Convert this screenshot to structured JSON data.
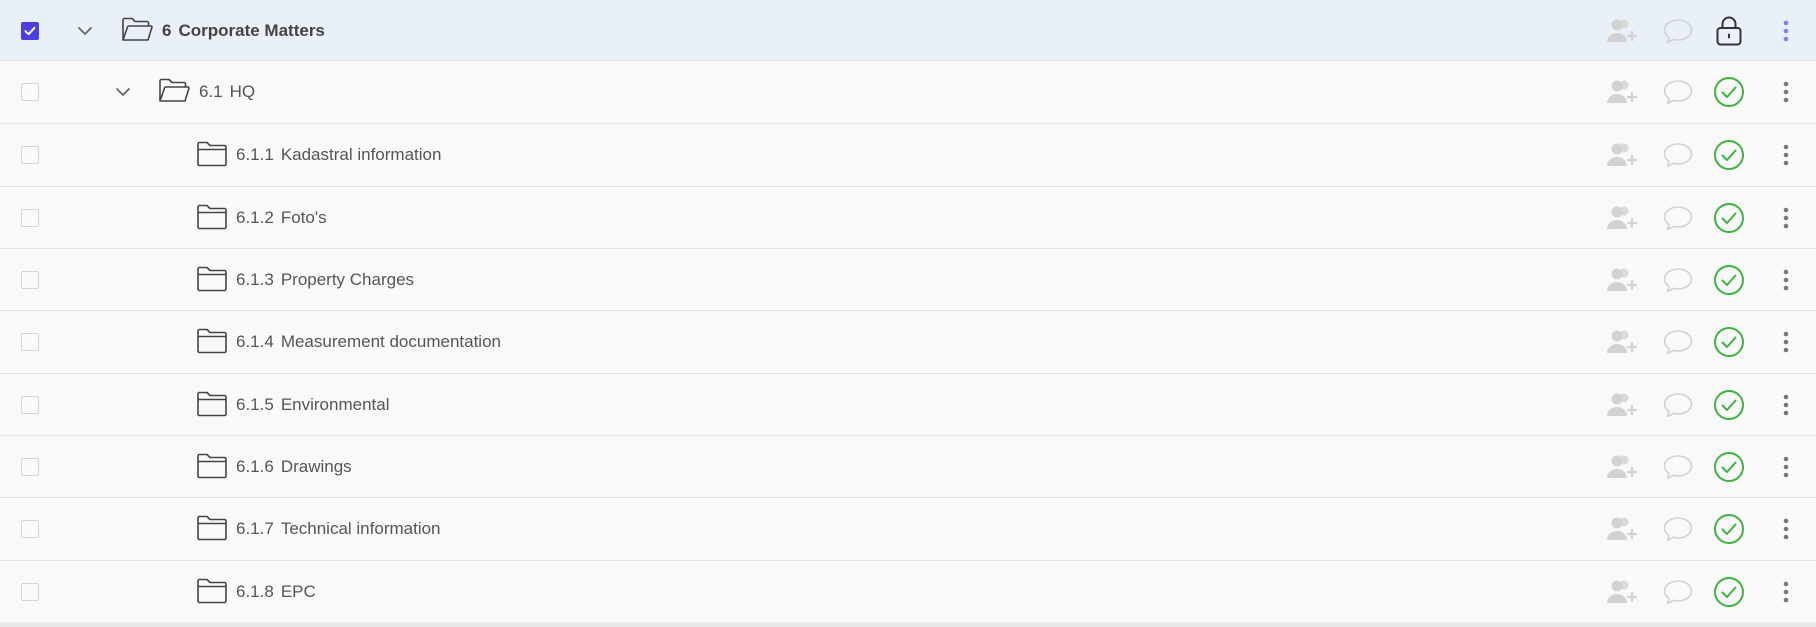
{
  "colors": {
    "accent": "#4a3ee0",
    "status_ok": "#3fb23f",
    "icon_muted": "#d2d2d2",
    "selected_row_bg": "#e9f0f8"
  },
  "rows": [
    {
      "num": "6",
      "title": "Corporate Matters",
      "level": 0,
      "expanded": true,
      "checked": true,
      "status": "locked",
      "icon": "folder-open-icon"
    },
    {
      "num": "6.1",
      "title": "HQ",
      "level": 1,
      "expanded": true,
      "checked": false,
      "status": "complete",
      "icon": "folder-open-icon"
    },
    {
      "num": "6.1.1",
      "title": "Kadastral information",
      "level": 2,
      "checked": false,
      "status": "complete",
      "icon": "folder-icon"
    },
    {
      "num": "6.1.2",
      "title": "Foto's",
      "level": 2,
      "checked": false,
      "status": "complete",
      "icon": "folder-icon"
    },
    {
      "num": "6.1.3",
      "title": "Property Charges",
      "level": 2,
      "checked": false,
      "status": "complete",
      "icon": "folder-icon"
    },
    {
      "num": "6.1.4",
      "title": "Measurement documentation",
      "level": 2,
      "checked": false,
      "status": "complete",
      "icon": "folder-icon"
    },
    {
      "num": "6.1.5",
      "title": "Environmental",
      "level": 2,
      "checked": false,
      "status": "complete",
      "icon": "folder-icon"
    },
    {
      "num": "6.1.6",
      "title": "Drawings",
      "level": 2,
      "checked": false,
      "status": "complete",
      "icon": "folder-icon"
    },
    {
      "num": "6.1.7",
      "title": "Technical information",
      "level": 2,
      "checked": false,
      "status": "complete",
      "icon": "folder-icon"
    },
    {
      "num": "6.1.8",
      "title": "EPC",
      "level": 2,
      "checked": false,
      "status": "complete",
      "icon": "folder-icon"
    }
  ]
}
